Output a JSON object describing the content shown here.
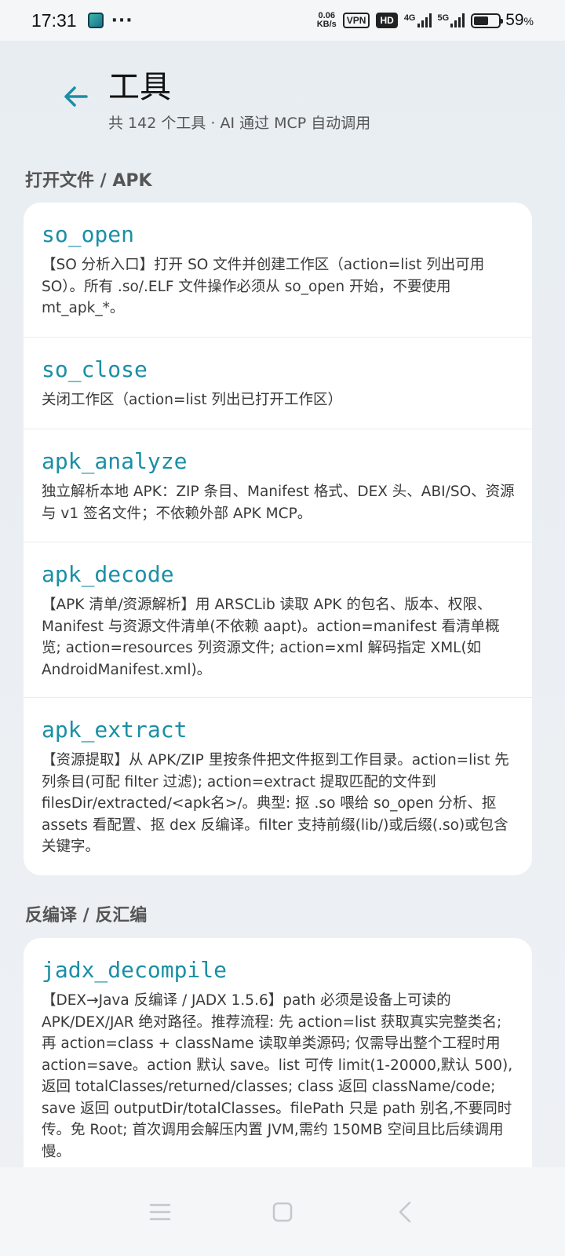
{
  "status": {
    "time": "17:31",
    "speed_top": "0.06",
    "speed_bottom": "KB/s",
    "vpn": "VPN",
    "hd": "HD",
    "net1": "4G",
    "net2": "5G",
    "battery_percent": "59",
    "battery_level": 0.59
  },
  "header": {
    "title": "工具",
    "subtitle": "共 142 个工具 · AI 通过 MCP 自动调用"
  },
  "sections": [
    {
      "label": "打开文件 / APK",
      "tools": [
        {
          "name": "so_open",
          "desc": "【SO 分析入口】打开 SO 文件并创建工作区（action=list 列出可用 SO）。所有 .so/.ELF 文件操作必须从 so_open 开始，不要使用 mt_apk_*。"
        },
        {
          "name": "so_close",
          "desc": "关闭工作区（action=list 列出已打开工作区）"
        },
        {
          "name": "apk_analyze",
          "desc": "独立解析本地 APK：ZIP 条目、Manifest 格式、DEX 头、ABI/SO、资源与 v1 签名文件；不依赖外部 APK MCP。"
        },
        {
          "name": "apk_decode",
          "desc": "【APK 清单/资源解析】用 ARSCLib 读取 APK 的包名、版本、权限、Manifest 与资源文件清单(不依赖 aapt)。action=manifest 看清单概览; action=resources 列资源文件; action=xml 解码指定 XML(如 AndroidManifest.xml)。"
        },
        {
          "name": "apk_extract",
          "desc": "【资源提取】从 APK/ZIP 里按条件把文件抠到工作目录。action=list 先列条目(可配 filter 过滤); action=extract 提取匹配的文件到 filesDir/extracted/<apk名>/。典型: 抠 .so 喂给 so_open 分析、抠 assets 看配置、抠 dex 反编译。filter 支持前缀(lib/)或后缀(.so)或包含关键字。"
        }
      ]
    },
    {
      "label": "反编译 / 反汇编",
      "tools": [
        {
          "name": "jadx_decompile",
          "desc": "【DEX→Java 反编译 / JADX 1.5.6】path 必须是设备上可读的 APK/DEX/JAR 绝对路径。推荐流程: 先 action=list 获取真实完整类名; 再 action=class + className 读取单类源码; 仅需导出整个工程时用 action=save。action 默认 save。list 可传 limit(1-20000,默认 500),返回 totalClasses/returned/classes; class 返回 className/code; save 返回 outputDir/totalClasses。filePath 只是 path 别名,不要同时传。免 Root; 首次调用会解压内置 JVM,需约 150MB 空间且比后续调用慢。"
        }
      ]
    }
  ]
}
